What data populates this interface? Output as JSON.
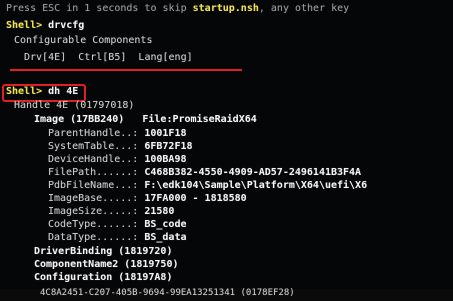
{
  "terminal": {
    "line_press_esc": {
      "pre": "Press ESC in 1 seconds to skip ",
      "script": "startup.nsh",
      "post": ", any other key"
    },
    "cmd1": {
      "prompt": "Shell> ",
      "command": "drvcfg"
    },
    "configurable": "Configurable Components",
    "components": {
      "drv": "Drv[4E]",
      "ctrl": "Ctrl[B5]",
      "lang": "Lang[eng]"
    },
    "cmd2": {
      "prompt": "Shell> ",
      "command": "dh 4E"
    },
    "handle": "Handle 4E (01797018)",
    "image_label": "Image (17BB240)",
    "image_file": "File:PromiseRaidX64",
    "fields": [
      {
        "key": "ParentHandle..:",
        "value": "1001F18"
      },
      {
        "key": "SystemTable...:",
        "value": "6FB72F18"
      },
      {
        "key": "DeviceHandle..:",
        "value": "100BA98"
      },
      {
        "key": "FilePath......:",
        "value": "C468B382-4550-4909-AD57-2496141B3F4A"
      },
      {
        "key": "PdbFileName...:",
        "value": "F:\\edk104\\Sample\\Platform\\X64\\uefi\\X6"
      },
      {
        "key": "ImageBase.....:",
        "value": "17FA000 - 1818580"
      },
      {
        "key": "ImageSize.....:",
        "value": "21580"
      },
      {
        "key": "CodeType......:",
        "value": "BS_code"
      },
      {
        "key": "DataType......:",
        "value": "BS_data"
      }
    ],
    "bindings": [
      "DriverBinding (1819720)",
      "ComponentName2 (1819750)",
      "Configuration (18197A8)"
    ],
    "last_line": "4C8A2451-C207-405B-9694-99EA13251341 (0178EF28)"
  },
  "colors": {
    "background": "#050607",
    "text": "#d6d6d6",
    "highlight": "#f2e24e",
    "annotation_red": "#e02020"
  }
}
